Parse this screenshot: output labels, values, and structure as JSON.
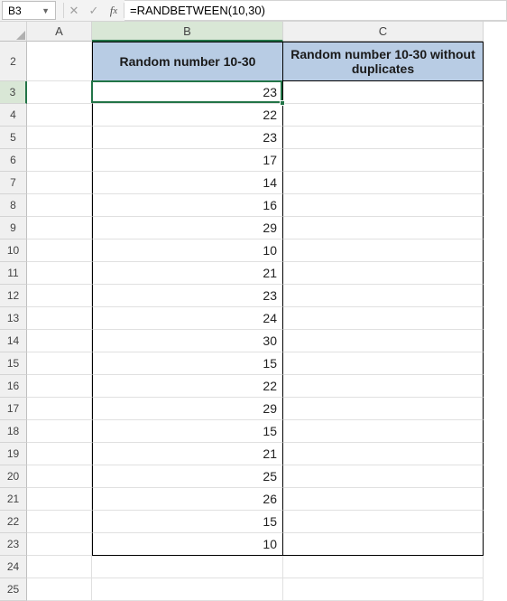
{
  "nameBox": "B3",
  "formula": "=RANDBETWEEN(10,30)",
  "columns": [
    "A",
    "B",
    "C"
  ],
  "activeColumn": "B",
  "activeRow": 3,
  "headers": {
    "B": "Random number 10-30",
    "C": "Random number 10-30 without duplicates"
  },
  "data": {
    "startRow": 3,
    "endRow": 23,
    "B": [
      23,
      22,
      23,
      17,
      14,
      16,
      29,
      10,
      21,
      23,
      24,
      30,
      15,
      22,
      29,
      15,
      21,
      25,
      26,
      15,
      10
    ],
    "C": [
      "",
      "",
      "",
      "",
      "",
      "",
      "",
      "",
      "",
      "",
      "",
      "",
      "",
      "",
      "",
      "",
      "",
      "",
      "",
      "",
      ""
    ]
  },
  "visibleRows": [
    2,
    3,
    4,
    5,
    6,
    7,
    8,
    9,
    10,
    11,
    12,
    13,
    14,
    15,
    16,
    17,
    18,
    19,
    20,
    21,
    22,
    23,
    24,
    25
  ]
}
